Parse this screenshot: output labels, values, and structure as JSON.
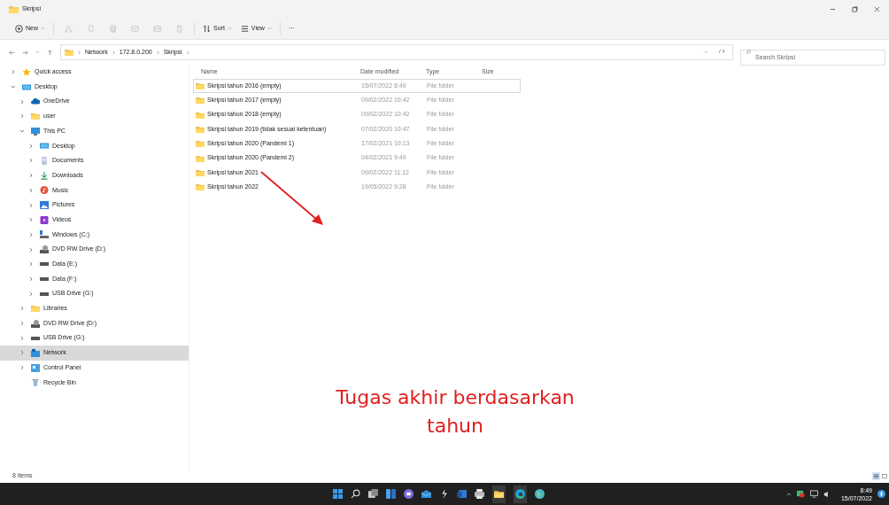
{
  "window": {
    "title": "Skripsi"
  },
  "toolbar": [
    {
      "kind": "new",
      "label": "New",
      "disabled": false
    },
    {
      "kind": "cut",
      "disabled": true
    },
    {
      "kind": "copy",
      "disabled": true
    },
    {
      "kind": "paste",
      "disabled": true
    },
    {
      "kind": "rename",
      "disabled": true
    },
    {
      "kind": "share",
      "disabled": true
    },
    {
      "kind": "delete",
      "disabled": true
    },
    {
      "kind": "sort",
      "label": "Sort",
      "disabled": false
    },
    {
      "kind": "view",
      "label": "View",
      "disabled": false
    },
    {
      "kind": "more",
      "label": "···",
      "disabled": false
    }
  ],
  "address": {
    "path": [
      "Network",
      "172.8.0.200",
      "Skripsi"
    ]
  },
  "search": {
    "placeholder": "Search Skripsi"
  },
  "sidebar": {
    "items": [
      {
        "label": "Quick access",
        "kind": "star",
        "expanded": false,
        "selected": false
      },
      {
        "label": "Desktop",
        "kind": "desktop",
        "expanded": true,
        "selected": false,
        "children": [
          {
            "label": "OneDrive",
            "kind": "cloud",
            "expanded": false,
            "selected": false
          },
          {
            "label": "user",
            "kind": "folder",
            "expanded": false,
            "selected": false
          },
          {
            "label": "This PC",
            "kind": "pc",
            "expanded": true,
            "selected": false,
            "children": [
              {
                "label": "Desktop",
                "kind": "desktop",
                "expanded": false,
                "selected": false
              },
              {
                "label": "Documents",
                "kind": "documents",
                "expanded": false,
                "selected": false
              },
              {
                "label": "Downloads",
                "kind": "download",
                "expanded": false,
                "selected": false
              },
              {
                "label": "Music",
                "kind": "music",
                "expanded": false,
                "selected": false
              },
              {
                "label": "Pictures",
                "kind": "pictures",
                "expanded": false,
                "selected": false
              },
              {
                "label": "Videos",
                "kind": "videos",
                "expanded": false,
                "selected": false
              },
              {
                "label": "Windows (C:)",
                "kind": "system-drive",
                "expanded": false,
                "selected": false
              },
              {
                "label": "DVD RW Drive (D:)",
                "kind": "dvd",
                "expanded": false,
                "selected": false
              },
              {
                "label": "Data (E:)",
                "kind": "drive",
                "expanded": false,
                "selected": false
              },
              {
                "label": "Data (F:)",
                "kind": "drive",
                "expanded": false,
                "selected": false
              },
              {
                "label": "USB Drive (G:)",
                "kind": "drive",
                "expanded": false,
                "selected": false
              }
            ]
          },
          {
            "label": "Libraries",
            "kind": "folder",
            "expanded": false,
            "selected": false
          },
          {
            "label": "DVD RW Drive (D:)",
            "kind": "dvd",
            "expanded": false,
            "selected": false
          },
          {
            "label": "USB Drive (G:)",
            "kind": "drive",
            "expanded": false,
            "selected": false
          },
          {
            "label": "Network",
            "kind": "network",
            "expanded": false,
            "selected": true
          },
          {
            "label": "Control Panel",
            "kind": "control-panel",
            "expanded": false,
            "selected": false
          },
          {
            "label": "Recycle Bin",
            "kind": "recycle",
            "selected": false
          }
        ]
      }
    ]
  },
  "table": {
    "columns": [
      "Name",
      "Date modified",
      "Type",
      "Size"
    ],
    "rows": [
      {
        "name": "Skripsi tahun 2016 (empty)",
        "date": "15/07/2022 8:49",
        "type": "File folder",
        "focused": true
      },
      {
        "name": "Skripsi tahun 2017 (empty)",
        "date": "09/02/2022 10:42",
        "type": "File folder",
        "focused": false
      },
      {
        "name": "Skripsi tahun 2018 (empty)",
        "date": "09/02/2022 10:42",
        "type": "File folder",
        "focused": false
      },
      {
        "name": "Skripsi tahun 2019 (tidak sesuai ketentuan)",
        "date": "07/02/2020 10:47",
        "type": "File folder",
        "focused": false
      },
      {
        "name": "Skripsi tahun 2020 (Pandemi 1)",
        "date": "17/02/2021 10:13",
        "type": "File folder",
        "focused": false
      },
      {
        "name": "Skripsi tahun 2020 (Pandemi 2)",
        "date": "04/02/2021 9:49",
        "type": "File folder",
        "focused": false
      },
      {
        "name": "Skripsi tahun 2021",
        "date": "09/02/2022 11:12",
        "type": "File folder",
        "focused": false
      },
      {
        "name": "Skripsi tahun 2022",
        "date": "19/05/2022 9:28",
        "type": "File folder",
        "focused": false
      }
    ]
  },
  "annotation": {
    "lines": [
      "Tugas akhir berdasarkan",
      "tahun"
    ]
  },
  "status_bar": {
    "items": "8 items"
  },
  "taskbar": {
    "time": "8:49",
    "date": "15/07/2022"
  }
}
